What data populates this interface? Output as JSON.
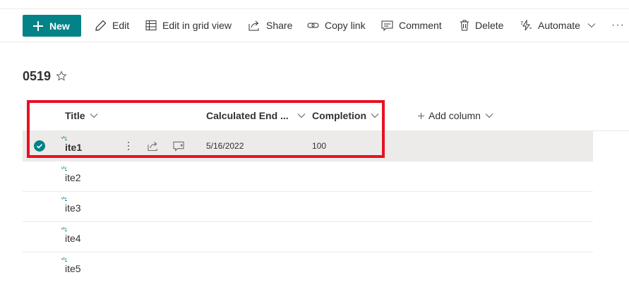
{
  "toolbar": {
    "new_label": "New",
    "edit_label": "Edit",
    "grid_label": "Edit in grid view",
    "share_label": "Share",
    "copy_link_label": "Copy link",
    "comment_label": "Comment",
    "delete_label": "Delete",
    "automate_label": "Automate",
    "more_label": "···"
  },
  "list": {
    "title": "0519"
  },
  "columns": {
    "title": "Title",
    "calculated_end": "Calculated End ...",
    "completion": "Completion",
    "add_column": "Add column"
  },
  "rows": [
    {
      "title": "ite1",
      "calculated_end": "5/16/2022",
      "completion": "100",
      "selected": true
    },
    {
      "title": "ite2",
      "calculated_end": "",
      "completion": "",
      "selected": false
    },
    {
      "title": "ite3",
      "calculated_end": "",
      "completion": "",
      "selected": false
    },
    {
      "title": "ite4",
      "calculated_end": "",
      "completion": "",
      "selected": false
    },
    {
      "title": "ite5",
      "calculated_end": "",
      "completion": "",
      "selected": false
    }
  ],
  "colors": {
    "accent": "#038387",
    "highlight": "#e81123",
    "selected_row": "#edebe9"
  }
}
